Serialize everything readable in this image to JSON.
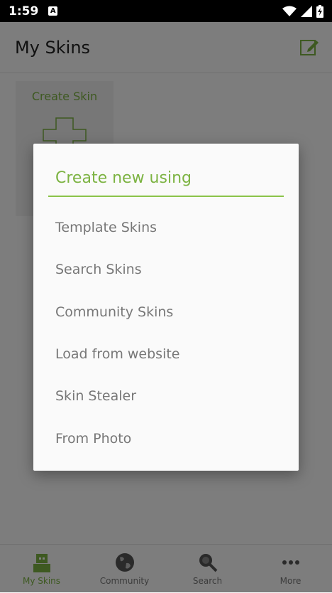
{
  "status_bar": {
    "time": "1:59",
    "notification_icon": "A"
  },
  "app_bar": {
    "title": "My Skins",
    "action_icon": "edit-icon"
  },
  "content": {
    "create_card_label": "Create Skin"
  },
  "bottom_nav": {
    "items": [
      {
        "label": "My Skins",
        "icon": "skin-icon",
        "active": true
      },
      {
        "label": "Community",
        "icon": "globe-icon",
        "active": false
      },
      {
        "label": "Search",
        "icon": "search-icon",
        "active": false
      },
      {
        "label": "More",
        "icon": "more-icon",
        "active": false
      }
    ]
  },
  "dialog": {
    "title": "Create new using",
    "options": [
      "Template Skins",
      "Search Skins",
      "Community Skins",
      "Load from website",
      "Skin Stealer",
      "From Photo"
    ]
  },
  "colors": {
    "accent": "#7cb342",
    "text_gray": "#777777"
  }
}
